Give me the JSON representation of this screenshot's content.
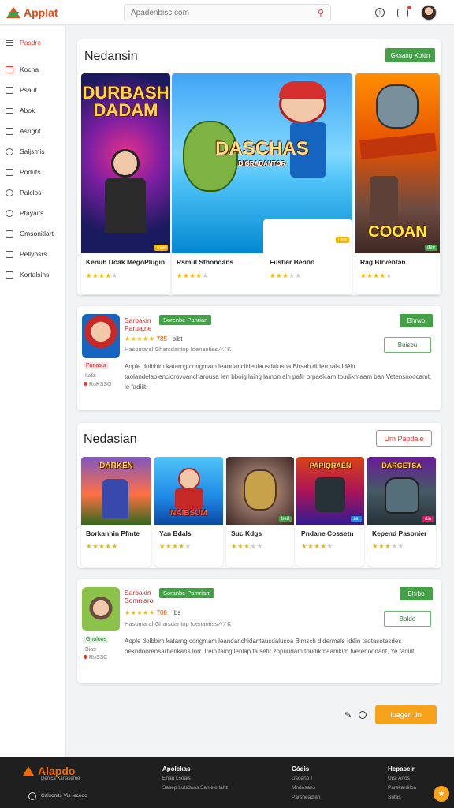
{
  "header": {
    "logo_text": "Applat",
    "search_placeholder": "Apadenbisc.com",
    "search_icon": "search-icon",
    "icons": [
      "timer-icon",
      "camera-icon",
      "avatar"
    ],
    "brand_color": "#e64a19"
  },
  "sidebar": {
    "items": [
      {
        "label": "Pasdre",
        "icon": "menu-icon"
      },
      {
        "label": "Kocha",
        "icon": "box-icon"
      },
      {
        "label": "Psaut",
        "icon": "box-icon"
      },
      {
        "label": "Abok",
        "icon": "list-icon"
      },
      {
        "label": "Asrigrit",
        "icon": "chat-icon"
      },
      {
        "label": "Saljsmis",
        "icon": "check-icon"
      },
      {
        "label": "Poduts",
        "icon": "box-icon"
      },
      {
        "label": "Palclos",
        "icon": "clock-icon"
      },
      {
        "label": "Ptayaits",
        "icon": "chat-icon"
      },
      {
        "label": "Cmsonitlart",
        "icon": "window-icon"
      },
      {
        "label": "Pellyosrs",
        "icon": "box-icon"
      },
      {
        "label": "Kortalsins",
        "icon": "home-icon"
      }
    ]
  },
  "featured": {
    "title": "Nedansin",
    "button": "Gksang Xoitin",
    "games": [
      {
        "name": "Kenuh Uoak MegoPlugin",
        "art_title": "DURBASH DADAM",
        "rating": 4,
        "badge": "new"
      },
      {
        "name": "Rsmul Sthondans",
        "art_title": "DASCHAS",
        "art_sub": "DIGRADANTOR",
        "rating": 4,
        "badge": ""
      },
      {
        "name": "Fustler Benbo",
        "art_title": "",
        "rating": 4,
        "badge": "new"
      },
      {
        "name": "Rag Blrventan",
        "art_title": "COOAN",
        "rating": 4,
        "badge": "dee"
      }
    ]
  },
  "app_one": {
    "name_line1": "Sarbakin",
    "name_line2": "Paruatne",
    "tag": "Sorenbe Panrian",
    "install_btn": "Bhrwo",
    "secondary_btn": "Buisbu",
    "rating_stars": "★★★★★",
    "rating_num": "785",
    "rating_extra": "bibt",
    "meta": "Hasomaral Gharsdantop Idenantiss ∕ ∕ ∕ K",
    "pill": "Panasur",
    "small1": "Iuda",
    "small2": "RuKSSO",
    "desc": "Aople dolbbim katarng congmam leandanciidenlausdalusoa Birsah didermals Idéin taolandelaplenclorovoancharousa Ien bboig laing lamon aln pafir orpaelcam toudikmaam ban Vetensnoocamt, le fadiiit."
  },
  "section_two": {
    "title": "Nedasian",
    "button": "Urn Papdale",
    "games": [
      {
        "name": "Borkanhin Pfmte",
        "art_title": "DARKEN",
        "rating": 5,
        "badge": ""
      },
      {
        "name": "Yan Bdals",
        "art_title": "NAIBSUM",
        "rating": 4,
        "badge": ""
      },
      {
        "name": "Suc Kdgs",
        "art_title": "",
        "rating": 3,
        "badge": "bed"
      },
      {
        "name": "Pndane Cossetn",
        "art_title": "PAPIQRAEN",
        "rating": 4,
        "badge": "sat"
      },
      {
        "name": "Kepend Pasonier",
        "art_title": "DARGETSA",
        "rating": 3,
        "badge": "dia"
      }
    ]
  },
  "app_two": {
    "name_line1": "Sarbakin",
    "name_line2": "Somniaro",
    "tag": "Soranbe Pamriam",
    "install_btn": "Bhrbo",
    "secondary_btn": "Baldo",
    "rating_stars": "★★★★★",
    "rating_num": "708",
    "rating_extra": "Ibs",
    "meta": "Hasomaral Gharsdantop Idenantiss ∕ ∕ ∕ K",
    "pill": "Gholoos",
    "small1": "Bias",
    "small2": "RuSSC",
    "desc": "Aople dolbbim katarng congmam leandanchidantausdalusoa Bimsch didermals Idéin taotasotesdes oekndoorensarhenkans lorr. Ireip taing lenlap ta sefir zopuridam toudikmaamkim Iverenoodant, Ye fadiiit."
  },
  "pager": {
    "icons": [
      "edit-icon",
      "info-icon"
    ],
    "button": "Iuagen Jn"
  },
  "footer": {
    "logo": "Alapdo",
    "logo_sub": "Denica Xanaserne",
    "bottom_text": "Calsonits Vis Iecedo",
    "columns": [
      {
        "title": "Apolekas",
        "links": [
          "Enan Lsoais",
          "Sasep Lulsdans Sanieie lahz"
        ]
      },
      {
        "title": "Códis",
        "links": [
          "Usoane I",
          "Mndosans",
          "Parsheadian"
        ]
      },
      {
        "title": "Hepaseir",
        "links": [
          "Ursi Anos",
          "Parskardiloa",
          "Sutas"
        ]
      }
    ],
    "accent": "#f7a21b"
  }
}
